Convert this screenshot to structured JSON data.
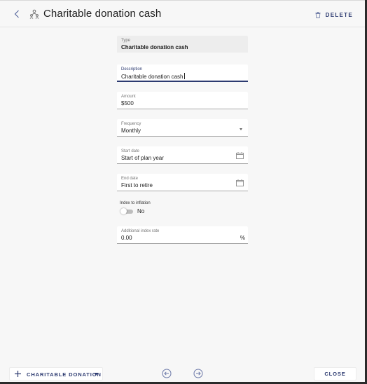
{
  "header": {
    "back_icon": "chevron-left-icon",
    "type_icon": "people-group-icon",
    "title": "Charitable donation cash",
    "delete_icon": "trash-icon",
    "delete_label": "DELETE"
  },
  "form": {
    "type": {
      "label": "Type",
      "value": "Charitable donation cash"
    },
    "description": {
      "label": "Description",
      "value": "Charitable donation cash"
    },
    "amount": {
      "label": "Amount",
      "value": "$500"
    },
    "frequency": {
      "label": "Frequency",
      "value": "Monthly"
    },
    "start_date": {
      "label": "Start date",
      "value": "Start of plan year",
      "icon": "calendar-icon"
    },
    "end_date": {
      "label": "End date",
      "value": "First to retire",
      "icon": "calendar-icon"
    },
    "index_to_inflation": {
      "label": "Index to inflation",
      "state_label": "No",
      "checked": false
    },
    "additional_index_rate": {
      "label": "Additional index rate",
      "value": "0.00",
      "suffix": "%"
    }
  },
  "footer": {
    "add_icon": "plus-icon",
    "add_label": "CHARITABLE DONATION",
    "prev_icon": "arrow-left-circle-icon",
    "next_icon": "arrow-right-circle-icon",
    "close_label": "CLOSE"
  },
  "colors": {
    "accent": "#2c3a70",
    "background": "#f7f7f7",
    "field_bg": "#ffffff",
    "readonly_bg": "#ededed"
  }
}
